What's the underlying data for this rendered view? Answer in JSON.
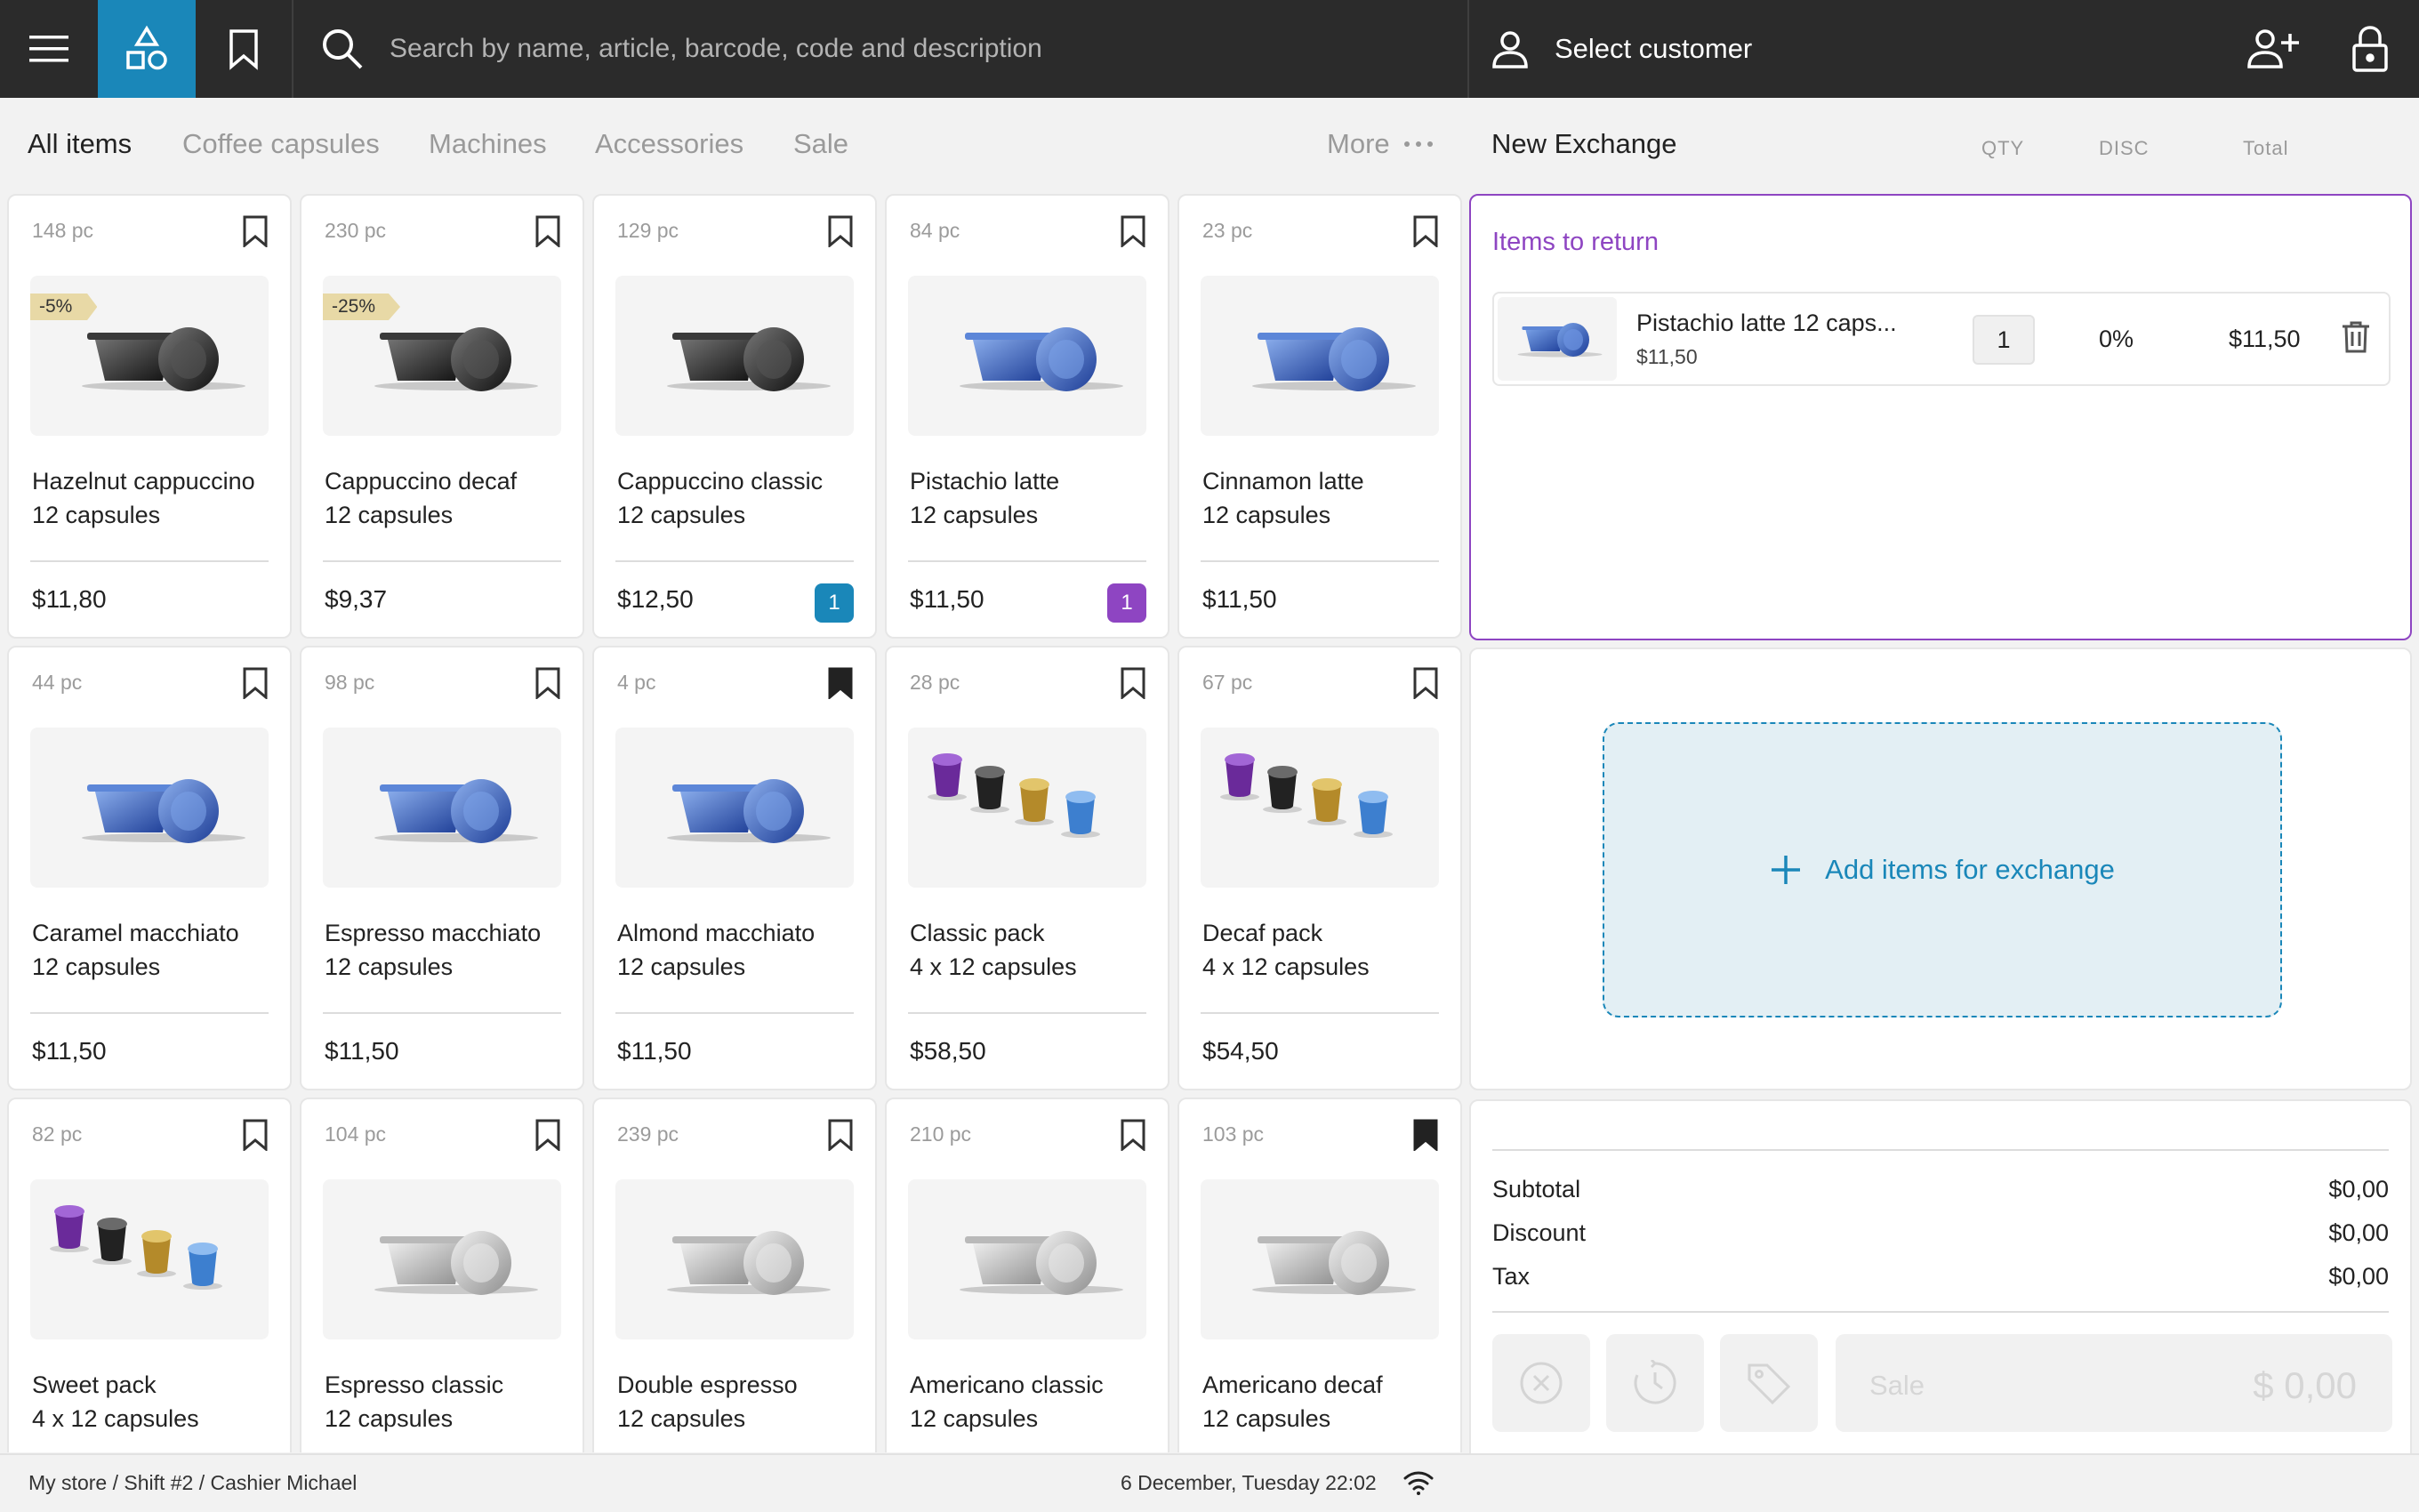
{
  "topbar": {
    "search_placeholder": "Search by name, article, barcode, code and description",
    "customer_label": "Select customer",
    "icons": [
      "menu-icon",
      "catalog-icon",
      "bookmark-icon",
      "search-icon",
      "user-icon",
      "add-user-icon",
      "lock-icon"
    ],
    "accent_color": "#1a87b9"
  },
  "tabs": [
    {
      "label": "All items",
      "active": true
    },
    {
      "label": "Coffee capsules",
      "active": false
    },
    {
      "label": "Machines",
      "active": false
    },
    {
      "label": "Accessories",
      "active": false
    },
    {
      "label": "Sale",
      "active": false
    }
  ],
  "more_label": "More",
  "products": [
    {
      "stock": "148 pc",
      "name1": "Hazelnut cappuccino",
      "name2": "12 capsules",
      "price": "$11,80",
      "discount": "-5%",
      "bookmarked": false,
      "image": "capsule-black",
      "badge": ""
    },
    {
      "stock": "230 pc",
      "name1": "Cappuccino decaf",
      "name2": "12 capsules",
      "price": "$9,37",
      "discount": "-25%",
      "bookmarked": false,
      "image": "capsule-black",
      "badge": ""
    },
    {
      "stock": "129 pc",
      "name1": "Cappuccino classic",
      "name2": "12 capsules",
      "price": "$12,50",
      "discount": "",
      "bookmarked": false,
      "image": "capsule-black",
      "badge": "1",
      "badge_color": "#1a87b9"
    },
    {
      "stock": "84 pc",
      "name1": "Pistachio latte",
      "name2": "12 capsules",
      "price": "$11,50",
      "discount": "",
      "bookmarked": false,
      "image": "capsule-blue",
      "badge": "1",
      "badge_color": "#8e45c2"
    },
    {
      "stock": "23 pc",
      "name1": "Cinnamon latte",
      "name2": "12 capsules",
      "price": "$11,50",
      "discount": "",
      "bookmarked": false,
      "image": "capsule-blue",
      "badge": ""
    },
    {
      "stock": "44 pc",
      "name1": "Caramel macchiato",
      "name2": "12 capsules",
      "price": "$11,50",
      "discount": "",
      "bookmarked": false,
      "image": "capsule-blue",
      "badge": ""
    },
    {
      "stock": "98 pc",
      "name1": "Espresso macchiato",
      "name2": "12 capsules",
      "price": "$11,50",
      "discount": "",
      "bookmarked": false,
      "image": "capsule-blue",
      "badge": ""
    },
    {
      "stock": "4 pc",
      "name1": "Almond macchiato",
      "name2": "12 capsules",
      "price": "$11,50",
      "discount": "",
      "bookmarked": true,
      "image": "capsule-blue",
      "badge": ""
    },
    {
      "stock": "28 pc",
      "name1": "Classic pack",
      "name2": "4 x 12 capsules",
      "price": "$58,50",
      "discount": "",
      "bookmarked": false,
      "image": "capsule-pack",
      "badge": ""
    },
    {
      "stock": "67 pc",
      "name1": "Decaf pack",
      "name2": "4 x 12 capsules",
      "price": "$54,50",
      "discount": "",
      "bookmarked": false,
      "image": "capsule-pack",
      "badge": ""
    },
    {
      "stock": "82 pc",
      "name1": "Sweet pack",
      "name2": "4 x 12 capsules",
      "price": "",
      "discount": "",
      "bookmarked": false,
      "image": "capsule-pack",
      "badge": ""
    },
    {
      "stock": "104 pc",
      "name1": "Espresso classic",
      "name2": "12 capsules",
      "price": "",
      "discount": "",
      "bookmarked": false,
      "image": "capsule-silver",
      "badge": ""
    },
    {
      "stock": "239 pc",
      "name1": "Double espresso",
      "name2": "12 capsules",
      "price": "",
      "discount": "",
      "bookmarked": false,
      "image": "capsule-silver",
      "badge": ""
    },
    {
      "stock": "210 pc",
      "name1": "Americano classic",
      "name2": "12 capsules",
      "price": "",
      "discount": "",
      "bookmarked": false,
      "image": "capsule-silver",
      "badge": ""
    },
    {
      "stock": "103 pc",
      "name1": "Americano decaf",
      "name2": "12 capsules",
      "price": "",
      "discount": "",
      "bookmarked": true,
      "image": "capsule-silver",
      "badge": ""
    }
  ],
  "exchange": {
    "title": "New Exchange",
    "col_qty": "QTY",
    "col_disc": "DISC",
    "col_total": "Total",
    "return_title": "Items to return",
    "return_color": "#8e45c2",
    "return_item": {
      "name": "Pistachio latte 12 caps...",
      "unit_price": "$11,50",
      "qty": "1",
      "disc": "0%",
      "total": "$11,50"
    },
    "add_label": "Add items for exchange"
  },
  "totals": {
    "subtotal_label": "Subtotal",
    "subtotal": "$0,00",
    "discount_label": "Discount",
    "discount": "$0,00",
    "tax_label": "Tax",
    "tax": "$0,00",
    "sale_label": "Sale",
    "sale_amount": "$ 0,00"
  },
  "status": {
    "location": "My store / Shift #2 / Cashier Michael",
    "datetime": "6 December, Tuesday 22:02"
  }
}
